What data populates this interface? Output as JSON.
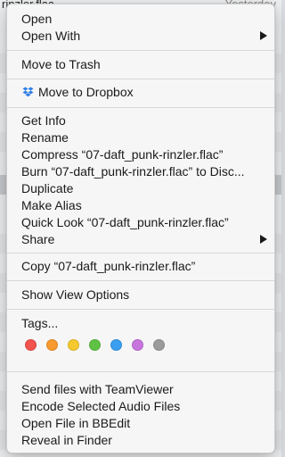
{
  "background": {
    "partial_filename": "rinzler.flac",
    "partial_date": "Yesterday"
  },
  "menu": {
    "open": "Open",
    "open_with": "Open With",
    "move_to_trash": "Move to Trash",
    "move_to_dropbox": "Move to Dropbox",
    "get_info": "Get Info",
    "rename": "Rename",
    "compress": "Compress “07-daft_punk-rinzler.flac”",
    "burn": "Burn “07-daft_punk-rinzler.flac” to Disc...",
    "duplicate": "Duplicate",
    "make_alias": "Make Alias",
    "quick_look": "Quick Look “07-daft_punk-rinzler.flac”",
    "share": "Share",
    "copy": "Copy “07-daft_punk-rinzler.flac”",
    "show_view_options": "Show View Options",
    "tags": "Tags...",
    "send_teamviewer": "Send files with TeamViewer",
    "encode_audio": "Encode Selected Audio Files",
    "open_bbedit": "Open File in BBEdit",
    "reveal_finder": "Reveal in Finder"
  },
  "icons": {
    "submenu": "chevron-right-icon",
    "dropbox": "dropbox-icon"
  },
  "tag_colors": [
    {
      "name": "red",
      "color": "#f2534c"
    },
    {
      "name": "orange",
      "color": "#f79a2f"
    },
    {
      "name": "yellow",
      "color": "#f5c92f"
    },
    {
      "name": "green",
      "color": "#5fc243"
    },
    {
      "name": "blue",
      "color": "#3a9ff0"
    },
    {
      "name": "purple",
      "color": "#c774dd"
    },
    {
      "name": "gray",
      "color": "#9b9b9b"
    }
  ]
}
